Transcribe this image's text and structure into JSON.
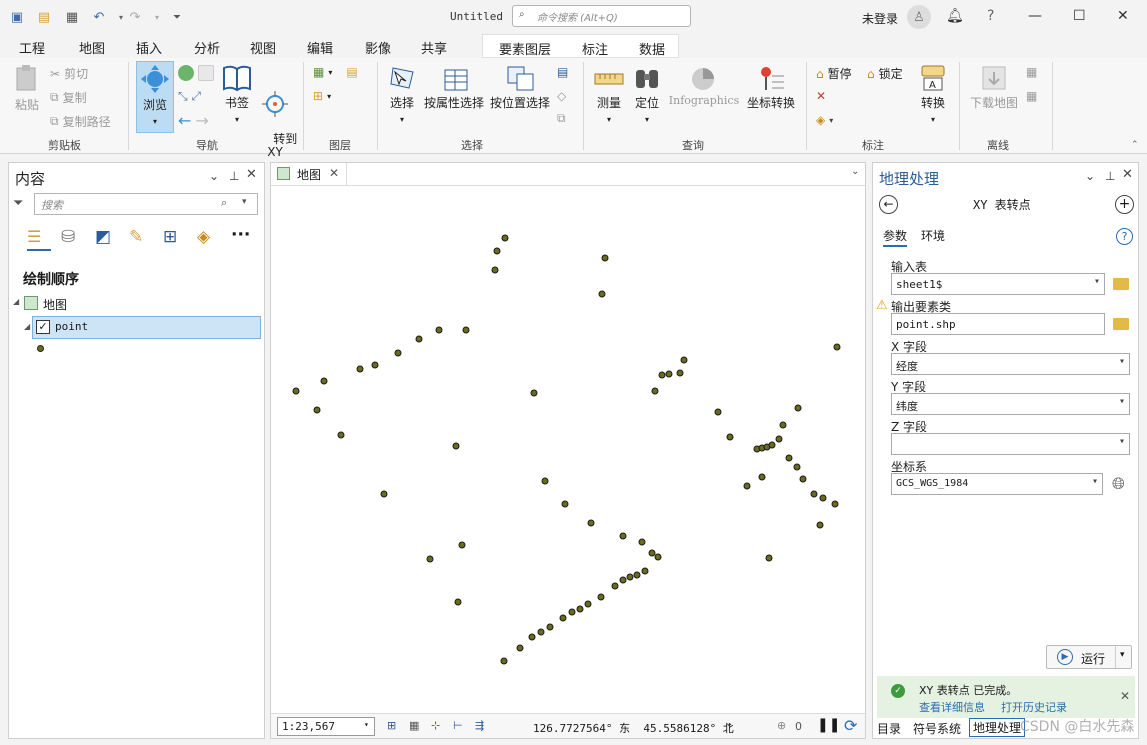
{
  "titlebar": {
    "title": "Untitled",
    "search_placeholder": "命令搜索 (Alt+Q)",
    "login": "未登录",
    "help": "?"
  },
  "tabs": [
    "工程",
    "地图",
    "插入",
    "分析",
    "视图",
    "编辑",
    "影像",
    "共享"
  ],
  "active_tab": "地图",
  "context_tabs": [
    "要素图层",
    "标注",
    "数据"
  ],
  "ribbon": {
    "clipboard": {
      "paste": "粘贴",
      "cut": "剪切",
      "copy": "复制",
      "copy_path": "复制路径",
      "label": "剪贴板"
    },
    "navigate": {
      "explore": "浏览",
      "bookmarks": "书签",
      "goto_xy": "转到\nXY",
      "label": "导航"
    },
    "layer": {
      "label": "图层"
    },
    "selection": {
      "select": "选择",
      "by_attr": "按属性选择",
      "by_loc": "按位置选择",
      "label": "选择"
    },
    "inquiry": {
      "measure": "测量",
      "locate": "定位",
      "infographics": "Infographics",
      "coord_convert": "坐标转换",
      "label": "查询"
    },
    "labeling": {
      "pause": "暂停",
      "lock": "锁定",
      "convert": "转换",
      "label": "标注"
    },
    "offline": {
      "download": "下载地图",
      "label": "离线"
    }
  },
  "contents": {
    "title": "内容",
    "search_placeholder": "搜索",
    "draw_order": "绘制顺序",
    "map_name": "地图",
    "layer_name": "point"
  },
  "map": {
    "tab": "地图",
    "scale": "1:23,567",
    "coords": "126.7727564° 东  45.5586128° 北",
    "selected_count": "0"
  },
  "geoprocessing": {
    "title": "地理处理",
    "tool": "XY 表转点",
    "tab_params": "参数",
    "tab_env": "环境",
    "input_table_label": "输入表",
    "input_table": "sheet1$",
    "output_label": "输出要素类",
    "output": "point.shp",
    "x_label": "X 字段",
    "x_value": "经度",
    "y_label": "Y 字段",
    "y_value": "纬度",
    "z_label": "Z 字段",
    "z_value": "",
    "cs_label": "坐标系",
    "cs_value": "GCS_WGS_1984",
    "run": "运行",
    "done_msg": "XY 表转点 已完成。",
    "details_link": "查看详细信息",
    "history_link": "打开历史记录"
  },
  "bottom_tabs": [
    "目录",
    "符号系统",
    "地理处理"
  ],
  "watermark": "CSDN @白水先森",
  "points": [
    [
      505,
      237
    ],
    [
      497,
      250
    ],
    [
      495,
      269
    ],
    [
      605,
      257
    ],
    [
      602,
      293
    ],
    [
      466,
      329
    ],
    [
      439,
      329
    ],
    [
      419,
      338
    ],
    [
      398,
      352
    ],
    [
      375,
      364
    ],
    [
      360,
      368
    ],
    [
      324,
      380
    ],
    [
      296,
      390
    ],
    [
      317,
      409
    ],
    [
      341,
      434
    ],
    [
      456,
      445
    ],
    [
      384,
      493
    ],
    [
      545,
      480
    ],
    [
      565,
      503
    ],
    [
      591,
      522
    ],
    [
      623,
      535
    ],
    [
      642,
      541
    ],
    [
      652,
      552
    ],
    [
      658,
      556
    ],
    [
      645,
      570
    ],
    [
      637,
      574
    ],
    [
      630,
      576
    ],
    [
      623,
      579
    ],
    [
      615,
      585
    ],
    [
      601,
      596
    ],
    [
      588,
      603
    ],
    [
      580,
      608
    ],
    [
      572,
      611
    ],
    [
      563,
      617
    ],
    [
      550,
      626
    ],
    [
      541,
      631
    ],
    [
      532,
      636
    ],
    [
      520,
      647
    ],
    [
      504,
      660
    ],
    [
      462,
      544
    ],
    [
      430,
      558
    ],
    [
      458,
      601
    ],
    [
      534,
      392
    ],
    [
      684,
      359
    ],
    [
      680,
      372
    ],
    [
      669,
      373
    ],
    [
      662,
      374
    ],
    [
      655,
      390
    ],
    [
      718,
      411
    ],
    [
      730,
      436
    ],
    [
      757,
      448
    ],
    [
      762,
      447
    ],
    [
      767,
      446
    ],
    [
      772,
      444
    ],
    [
      779,
      438
    ],
    [
      783,
      424
    ],
    [
      798,
      407
    ],
    [
      789,
      457
    ],
    [
      797,
      466
    ],
    [
      803,
      478
    ],
    [
      762,
      476
    ],
    [
      747,
      485
    ],
    [
      814,
      493
    ],
    [
      823,
      497
    ],
    [
      835,
      503
    ],
    [
      820,
      524
    ],
    [
      769,
      557
    ],
    [
      837,
      346
    ]
  ]
}
